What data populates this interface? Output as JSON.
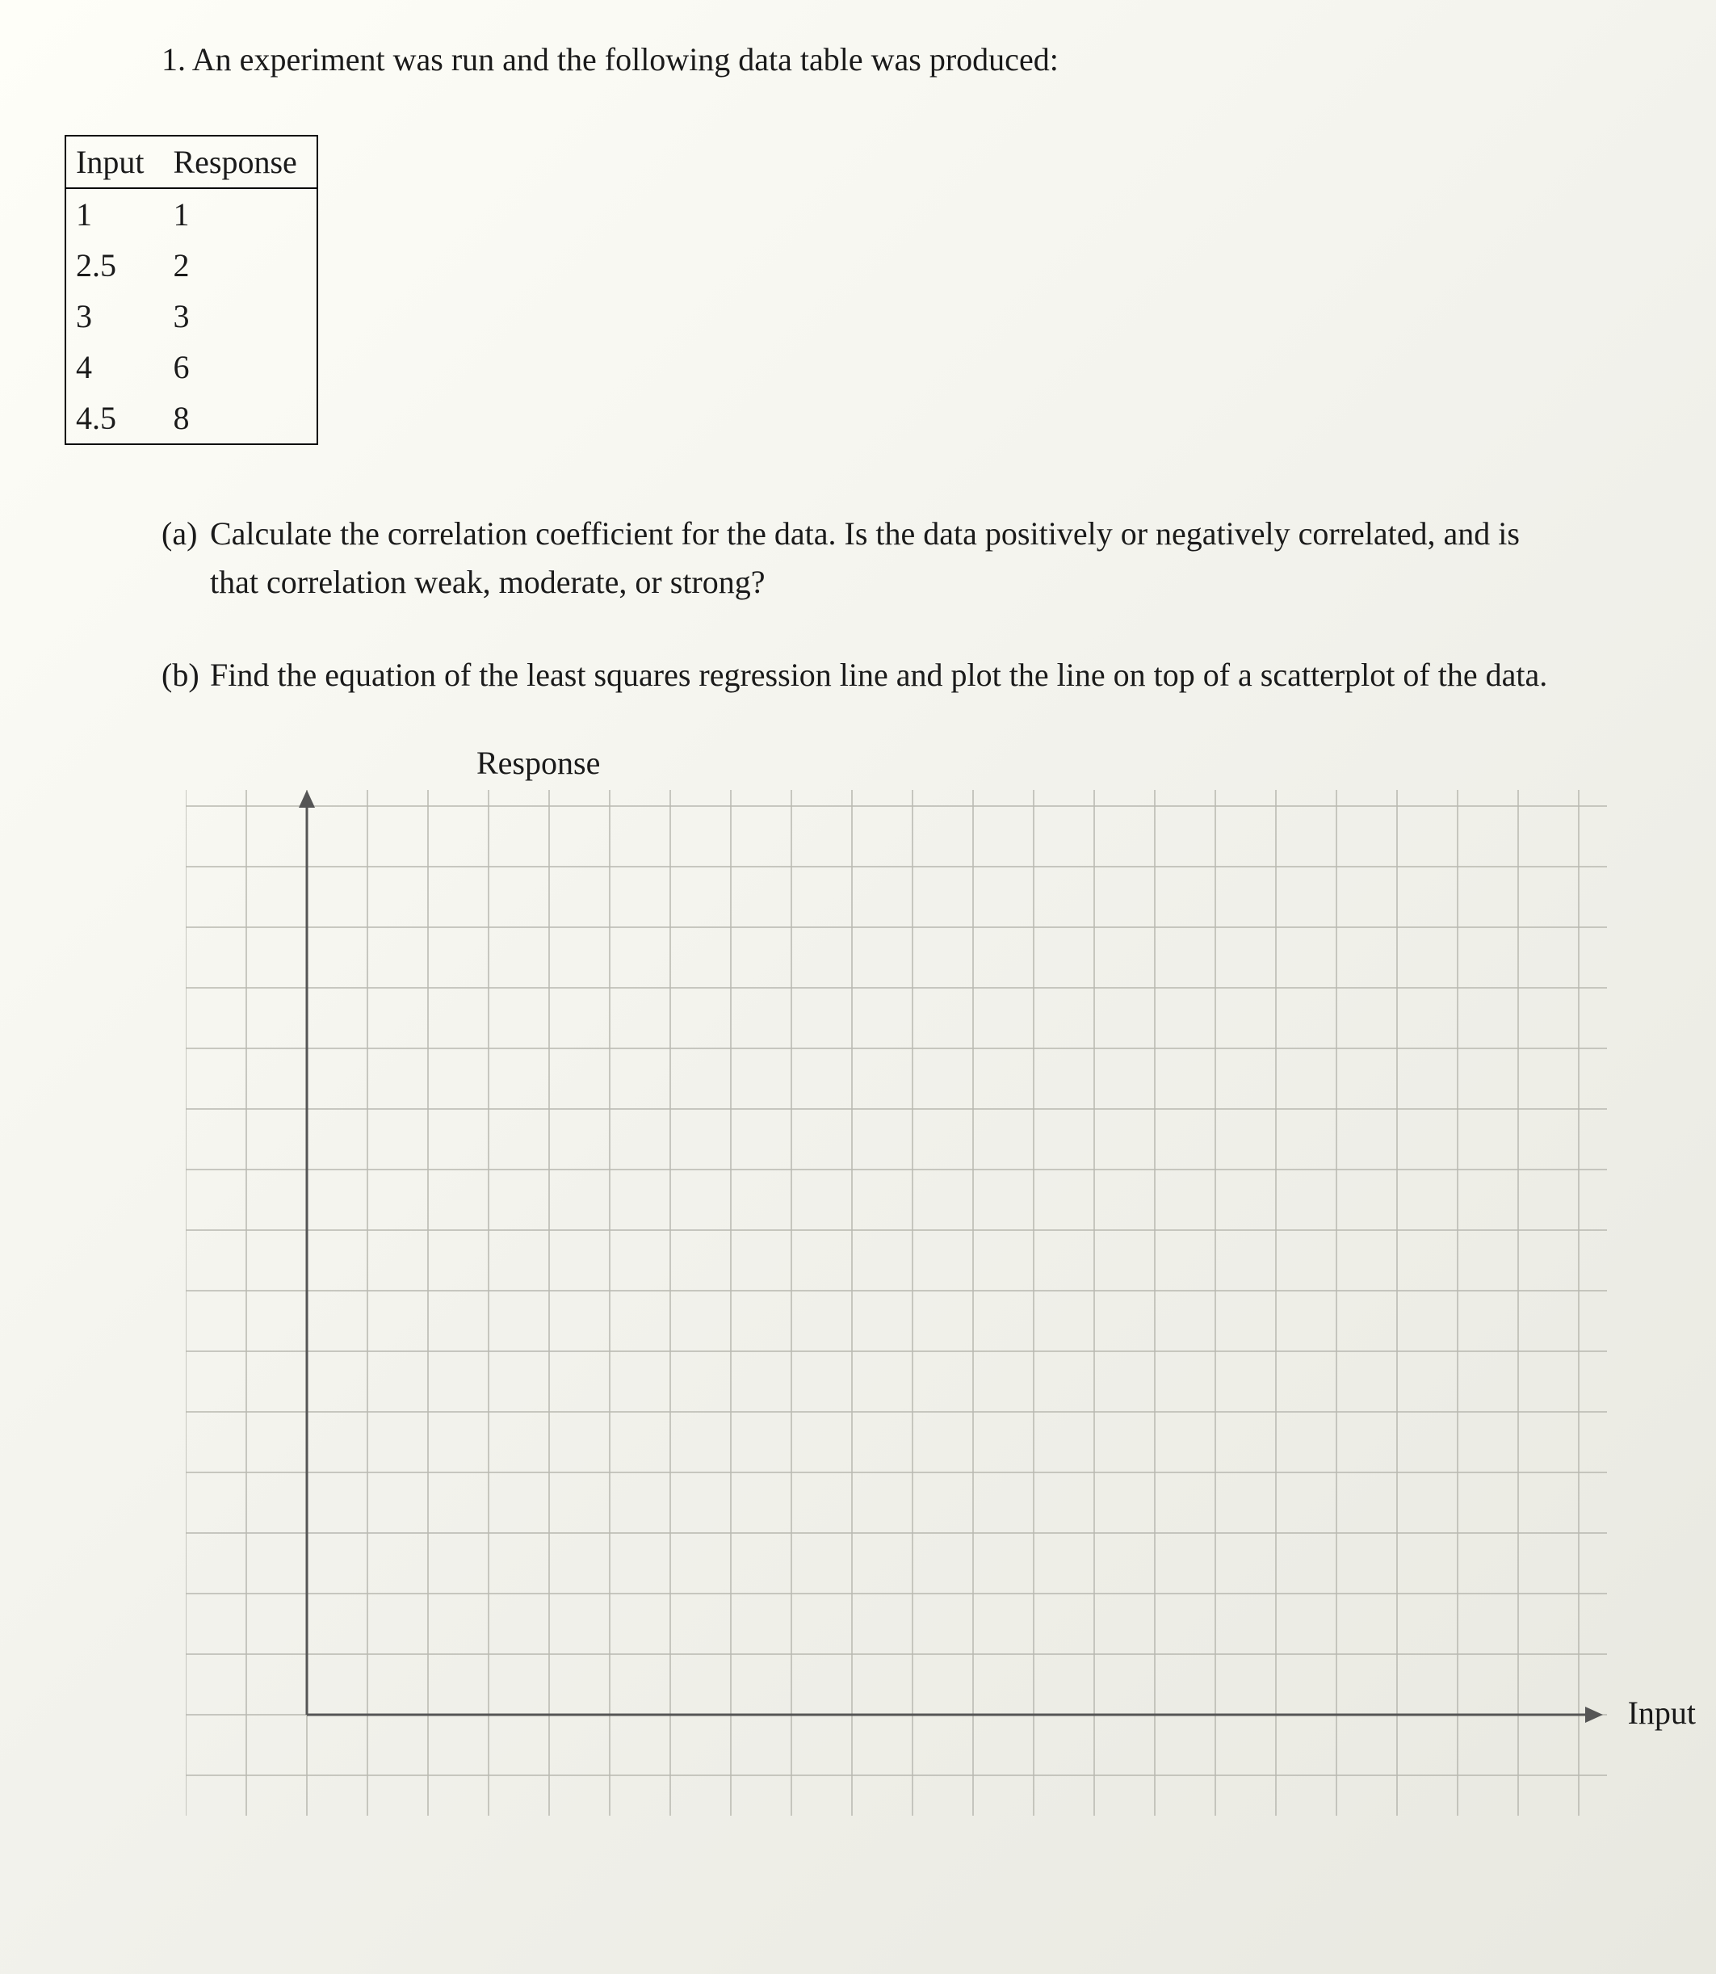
{
  "question": {
    "number": "1.",
    "text": "An experiment was run and the following data table was produced:"
  },
  "table": {
    "headers": [
      "Input",
      "Response"
    ],
    "rows": [
      {
        "input": "1",
        "response": "1"
      },
      {
        "input": "2.5",
        "response": "2"
      },
      {
        "input": "3",
        "response": "3"
      },
      {
        "input": "4",
        "response": "6"
      },
      {
        "input": "4.5",
        "response": "8"
      }
    ]
  },
  "parts": {
    "a": {
      "label": "(a)",
      "text": "Calculate the correlation coefficient for the data. Is the data positively or negatively correlated, and is that correlation weak, moderate, or strong?"
    },
    "b": {
      "label": "(b)",
      "text": "Find the equation of the least squares regression line and plot the line on top of a scatterplot of the data."
    }
  },
  "graph": {
    "ylabel": "Response",
    "xlabel": "Input"
  },
  "chart_data": {
    "type": "scatter",
    "title": "",
    "xlabel": "Input",
    "ylabel": "Response",
    "x": [
      1,
      2.5,
      3,
      4,
      4.5
    ],
    "y": [
      1,
      2,
      3,
      6,
      8
    ],
    "grid": true,
    "axes_drawn": true,
    "plotted_points": false
  }
}
